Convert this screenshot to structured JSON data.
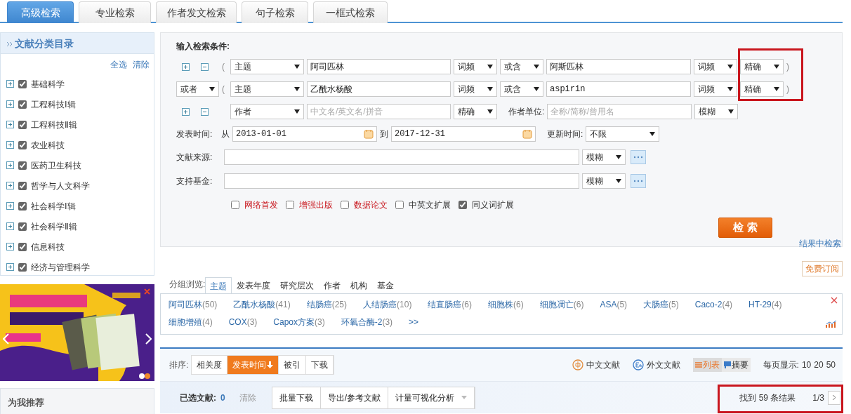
{
  "tabs": [
    {
      "label": "高级检索",
      "selected": true
    },
    {
      "label": "专业检索",
      "selected": false
    },
    {
      "label": "作者发文检索",
      "selected": false
    },
    {
      "label": "句子检索",
      "selected": false
    },
    {
      "label": "一框式检索",
      "selected": false
    }
  ],
  "sidebar": {
    "title": "文献分类目录",
    "select_all": "全选",
    "clear": "清除",
    "items": [
      {
        "label": "基础科学",
        "checked": true
      },
      {
        "label": "工程科技Ⅰ辑",
        "checked": true
      },
      {
        "label": "工程科技Ⅱ辑",
        "checked": true
      },
      {
        "label": "农业科技",
        "checked": true
      },
      {
        "label": "医药卫生科技",
        "checked": true
      },
      {
        "label": "哲学与人文科学",
        "checked": true
      },
      {
        "label": "社会科学Ⅰ辑",
        "checked": true
      },
      {
        "label": "社会科学Ⅱ辑",
        "checked": true
      },
      {
        "label": "信息科技",
        "checked": true
      },
      {
        "label": "经济与管理科学",
        "checked": true
      }
    ]
  },
  "recommend": {
    "title": "为我推荐"
  },
  "search": {
    "heading": "输入检索条件:",
    "rows": [
      {
        "kind": "term",
        "open": "(",
        "field": "主题",
        "value": "阿司匹林",
        "freq": "词频",
        "join": "或含",
        "value2": "阿斯匹林",
        "freq2": "词频",
        "match": "精确",
        "close": ")"
      },
      {
        "kind": "term",
        "logic": "或者",
        "open": "(",
        "field": "主题",
        "value": "乙酰水杨酸",
        "freq": "词频",
        "join": "或含",
        "value2": "aspirin",
        "freq2": "词频",
        "match": "精确",
        "close": ")"
      },
      {
        "kind": "author",
        "field": "作者",
        "placeholder": "中文名/英文名/拼音",
        "match": "精确",
        "org_label": "作者单位:",
        "org_placeholder": "全称/简称/曾用名",
        "org_match": "模糊"
      }
    ],
    "date": {
      "label": "发表时间:",
      "from_label": "从",
      "from": "2013-01-01",
      "to_label": "到",
      "to": "2017-12-31",
      "update_label": "更新时间:",
      "update": "不限"
    },
    "source": {
      "label": "文献来源:",
      "match": "模糊"
    },
    "fund": {
      "label": "支持基金:",
      "match": "模糊"
    },
    "options": [
      {
        "label": "网络首发",
        "checked": false,
        "kind": "featured"
      },
      {
        "label": "增强出版",
        "checked": false,
        "kind": "featured"
      },
      {
        "label": "数据论文",
        "checked": false,
        "kind": "featured"
      },
      {
        "label": "中英文扩展",
        "checked": false,
        "kind": "plain"
      },
      {
        "label": "同义词扩展",
        "checked": true,
        "kind": "plain"
      }
    ],
    "button": "检 索",
    "in_results": "结果中检索"
  },
  "subscribe": "免费订阅",
  "group": {
    "label": "分组浏览:",
    "tabs": [
      {
        "label": "主题",
        "selected": true
      },
      {
        "label": "发表年度",
        "selected": false
      },
      {
        "label": "研究层次",
        "selected": false
      },
      {
        "label": "作者",
        "selected": false
      },
      {
        "label": "机构",
        "selected": false
      },
      {
        "label": "基金",
        "selected": false
      }
    ],
    "terms": [
      {
        "name": "阿司匹林",
        "count": "(50)"
      },
      {
        "name": "乙酰水杨酸",
        "count": "(41)"
      },
      {
        "name": "结肠癌",
        "count": "(25)"
      },
      {
        "name": "人结肠癌",
        "count": "(10)"
      },
      {
        "name": "结直肠癌",
        "count": "(6)"
      },
      {
        "name": "细胞株",
        "count": "(6)"
      },
      {
        "name": "细胞凋亡",
        "count": "(6)"
      },
      {
        "name": "ASA",
        "count": "(5)"
      },
      {
        "name": "大肠癌",
        "count": "(5)"
      },
      {
        "name": "Caco-2",
        "count": "(4)"
      },
      {
        "name": "HT-29",
        "count": "(4)"
      },
      {
        "name": "细胞增殖",
        "count": "(4)"
      },
      {
        "name": "COX",
        "count": "(3)"
      },
      {
        "name": "Capox方案",
        "count": "(3)"
      },
      {
        "name": "环氧合酶-2",
        "count": "(3)"
      }
    ],
    "more": ">>"
  },
  "results": {
    "sort_label": "排序:",
    "sort": [
      {
        "label": "相关度",
        "selected": false
      },
      {
        "label": "发表时间",
        "selected": true
      },
      {
        "label": "被引",
        "selected": false
      },
      {
        "label": "下载",
        "selected": false
      }
    ],
    "langs": [
      {
        "label": "中文文献",
        "kind": "zh"
      },
      {
        "label": "外文文献",
        "kind": "en"
      }
    ],
    "views": [
      {
        "label": "列表",
        "selected": true
      },
      {
        "label": "摘要",
        "selected": false
      }
    ],
    "per_page_label": "每页显示:",
    "per_page": [
      "10",
      "20",
      "50"
    ],
    "selected_label": "已选文献:",
    "selected_count": "0",
    "clear": "清除",
    "actions": [
      {
        "label": "批量下载"
      },
      {
        "label": "导出/参考文献"
      },
      {
        "label": "计量可视化分析",
        "dropdown": true
      }
    ],
    "found": "找到 59 条结果",
    "page": "1/3"
  }
}
